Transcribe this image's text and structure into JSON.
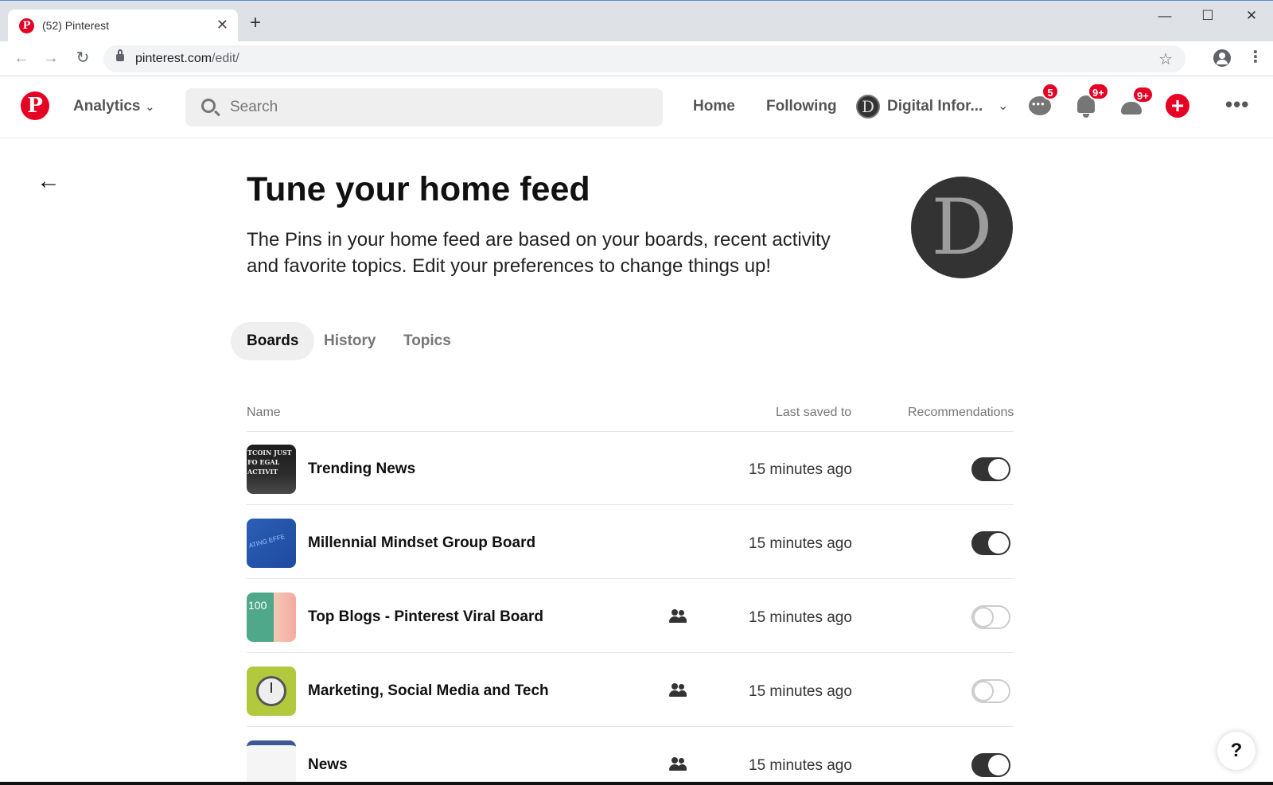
{
  "browser": {
    "tab_title": "(52) Pinterest",
    "tab_close": "✕",
    "new_tab": "+",
    "url_host": "pinterest.com",
    "url_path": "/edit/",
    "window_min": "—",
    "window_max": "☐",
    "window_close": "✕"
  },
  "header": {
    "logo_letter": "P",
    "analytics_label": "Analytics",
    "search_placeholder": "Search",
    "home_label": "Home",
    "following_label": "Following",
    "account_initial": "D",
    "account_name": "Digital Infor...",
    "messages_badge": "5",
    "notifications_badge": "9+",
    "updates_badge": "9+"
  },
  "page": {
    "title": "Tune your home feed",
    "description": "The Pins in your home feed are based on your boards, recent activity and favorite topics. Edit your preferences to change things up!",
    "avatar_initial": "D",
    "tabs": [
      {
        "label": "Boards",
        "active": true
      },
      {
        "label": "History",
        "active": false
      },
      {
        "label": "Topics",
        "active": false
      }
    ],
    "columns": {
      "name": "Name",
      "last_saved": "Last saved to",
      "recommendations": "Recommendations"
    },
    "boards": [
      {
        "name": "Trending News",
        "group": false,
        "last_saved": "15 minutes ago",
        "recommendations": true,
        "thumb_text": "TCOIN JUST FO EGAL ACTIVIT"
      },
      {
        "name": "Millennial Mindset Group Board",
        "group": false,
        "last_saved": "15 minutes ago",
        "recommendations": true,
        "thumb_text": "ATING EFFE"
      },
      {
        "name": "Top Blogs - Pinterest Viral Board",
        "group": true,
        "last_saved": "15 minutes ago",
        "recommendations": false,
        "thumb_text": "100"
      },
      {
        "name": "Marketing, Social Media and Tech",
        "group": true,
        "last_saved": "15 minutes ago",
        "recommendations": false,
        "thumb_text": ""
      },
      {
        "name": "News",
        "group": true,
        "last_saved": "15 minutes ago",
        "recommendations": true,
        "thumb_text": ""
      }
    ]
  },
  "help": {
    "label": "?"
  }
}
